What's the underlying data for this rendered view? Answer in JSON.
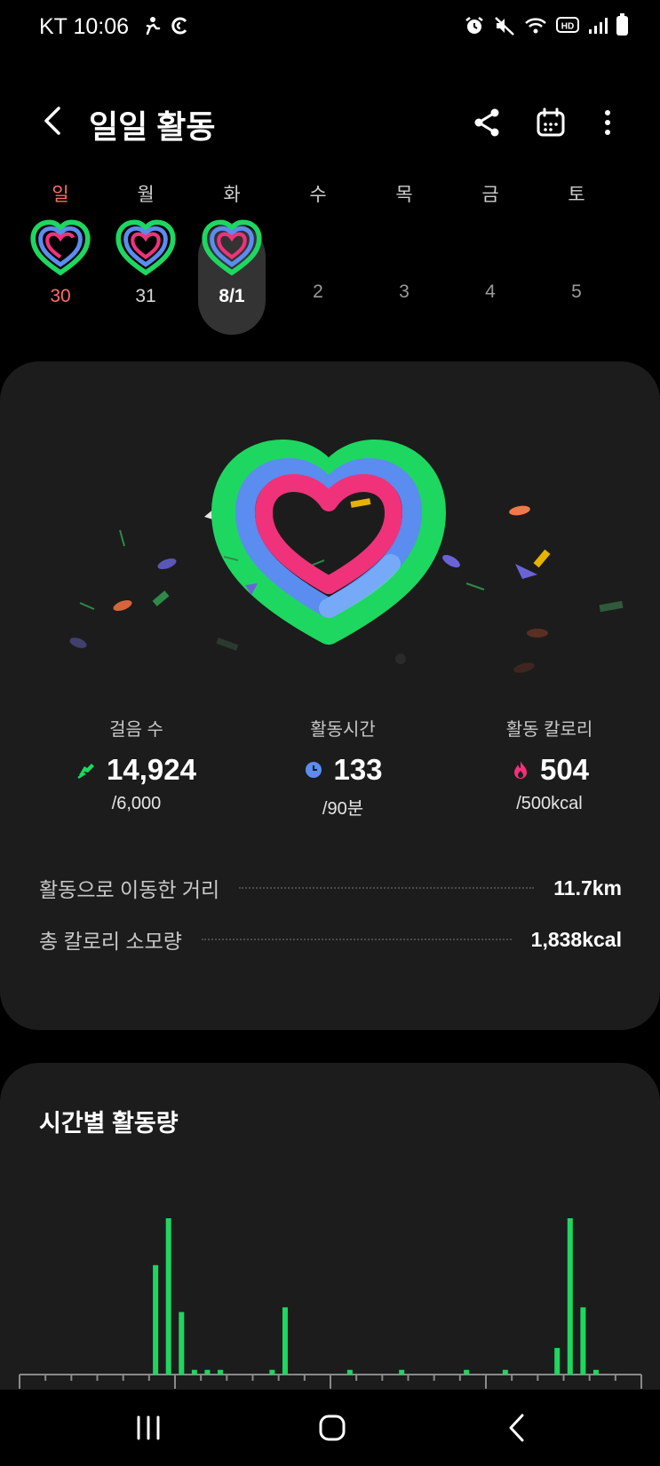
{
  "status_bar": {
    "carrier_time": "KT 10:06",
    "left_icons": [
      "fitness-icon",
      "data-saver-icon"
    ],
    "right_icons": [
      "alarm-icon",
      "mute-icon",
      "wifi-icon",
      "hd-voice-icon",
      "signal-icon",
      "battery-icon"
    ]
  },
  "header": {
    "title": "일일 활동",
    "back_icon": "back-chevron-icon",
    "actions": [
      "share-icon",
      "calendar-icon",
      "more-icon"
    ]
  },
  "week": [
    {
      "name": "일",
      "num": "30",
      "has_ring": true,
      "sunday": true,
      "selected": false
    },
    {
      "name": "월",
      "num": "31",
      "has_ring": true,
      "sunday": false,
      "selected": false
    },
    {
      "name": "화",
      "num": "8/1",
      "has_ring": true,
      "sunday": false,
      "selected": true
    },
    {
      "name": "수",
      "num": "2",
      "has_ring": false,
      "sunday": false,
      "selected": false
    },
    {
      "name": "목",
      "num": "3",
      "has_ring": false,
      "sunday": false,
      "selected": false
    },
    {
      "name": "금",
      "num": "4",
      "has_ring": false,
      "sunday": false,
      "selected": false
    },
    {
      "name": "토",
      "num": "5",
      "has_ring": false,
      "sunday": false,
      "selected": false
    }
  ],
  "summary": {
    "steps": {
      "label": "걸음 수",
      "value": "14,924",
      "goal": "/6,000",
      "icon": "shoe-icon"
    },
    "active_time": {
      "label": "활동시간",
      "value": "133",
      "goal": "/90분",
      "icon": "clock-icon"
    },
    "active_calories": {
      "label": "활동 칼로리",
      "value": "504",
      "goal": "/500kcal",
      "icon": "flame-icon"
    },
    "distance": {
      "label": "활동으로 이동한 거리",
      "value": "11.7km"
    },
    "total_calories": {
      "label": "총 칼로리 소모량",
      "value": "1,838kcal"
    }
  },
  "hourly": {
    "title": "시간별 활동량"
  },
  "colors": {
    "steps_green": "#1ed760",
    "time_blue": "#5b8cf0",
    "calories_pink": "#f0327a",
    "card_bg": "#1c1c1c",
    "sunday_red": "#ff6b6b"
  },
  "chart_data": {
    "type": "bar",
    "title": "시간별 활동량",
    "xlabel": "",
    "ylabel": "",
    "x": [
      0,
      1,
      2,
      3,
      4,
      5,
      6,
      7,
      8,
      9,
      10,
      11,
      12,
      13,
      14,
      15,
      16,
      17,
      18,
      19,
      20,
      21,
      22,
      23,
      24,
      25,
      26,
      27,
      28,
      29,
      30,
      31,
      32,
      33,
      34,
      35,
      36,
      37,
      38,
      39,
      40,
      41,
      42,
      43,
      44,
      45,
      46,
      47
    ],
    "values": [
      0,
      0,
      0,
      0,
      0,
      0,
      0,
      0,
      0,
      0,
      70,
      100,
      40,
      3,
      3,
      3,
      0,
      0,
      0,
      3,
      43,
      0,
      0,
      0,
      0,
      3,
      0,
      0,
      0,
      3,
      0,
      0,
      0,
      0,
      3,
      0,
      0,
      3,
      0,
      0,
      0,
      17,
      100,
      43,
      3,
      0,
      0,
      0
    ],
    "ylim": [
      0,
      100
    ],
    "grid": false
  }
}
